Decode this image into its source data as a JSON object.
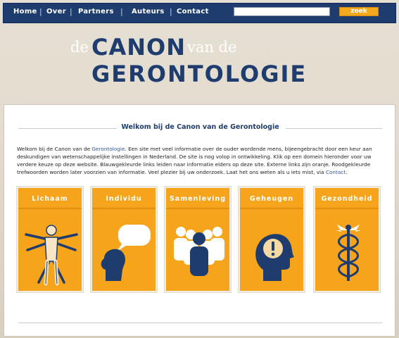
{
  "nav": {
    "items": [
      {
        "label": "Home"
      },
      {
        "label": "Over"
      },
      {
        "label": "Partners"
      },
      {
        "label": "Auteurs"
      },
      {
        "label": "Contact"
      }
    ],
    "separator": "|",
    "search_value": "",
    "search_button": "zoek"
  },
  "logo": {
    "de": "de",
    "canon": "CANON",
    "vande": "van de",
    "gerontologie": "GERONTOLOGIE"
  },
  "welcome": {
    "title": "Welkom bij de Canon van de Gerontologie"
  },
  "intro": {
    "part1": "Welkom bij de Canon van de ",
    "link1": "Gerontologie",
    "part2": ". Een site met veel informatie over de ouder wordende mens, bijeengebracht door een keur aan deskundigen van wetenschappelijke instellingen in Nederland. De site is nog volop in ontwikkeling. Klik op een domein hieronder voor uw verdere keuze op deze website. Blauwgekleurde links leiden naar informatie elders op deze site. Externe links zijn oranje. Roodgekleurde trefwoorden worden later voorzien van informatie. Veel plezier bij uw onderzoek. Laat het ons weten als u iets mist, via ",
    "link2": "Contact",
    "part3": "."
  },
  "tiles": [
    {
      "label": "Lichaam",
      "icon": "vitruvian-man-icon"
    },
    {
      "label": "Individu",
      "icon": "head-speech-bubble-icon"
    },
    {
      "label": "Samenleving",
      "icon": "people-group-icon"
    },
    {
      "label": "Geheugen",
      "icon": "head-exclamation-icon"
    },
    {
      "label": "Gezondheid",
      "icon": "caduceus-icon"
    }
  ],
  "colors": {
    "navy": "#1e3d6e",
    "orange": "#f5a41b",
    "background": "#e3dccf"
  }
}
